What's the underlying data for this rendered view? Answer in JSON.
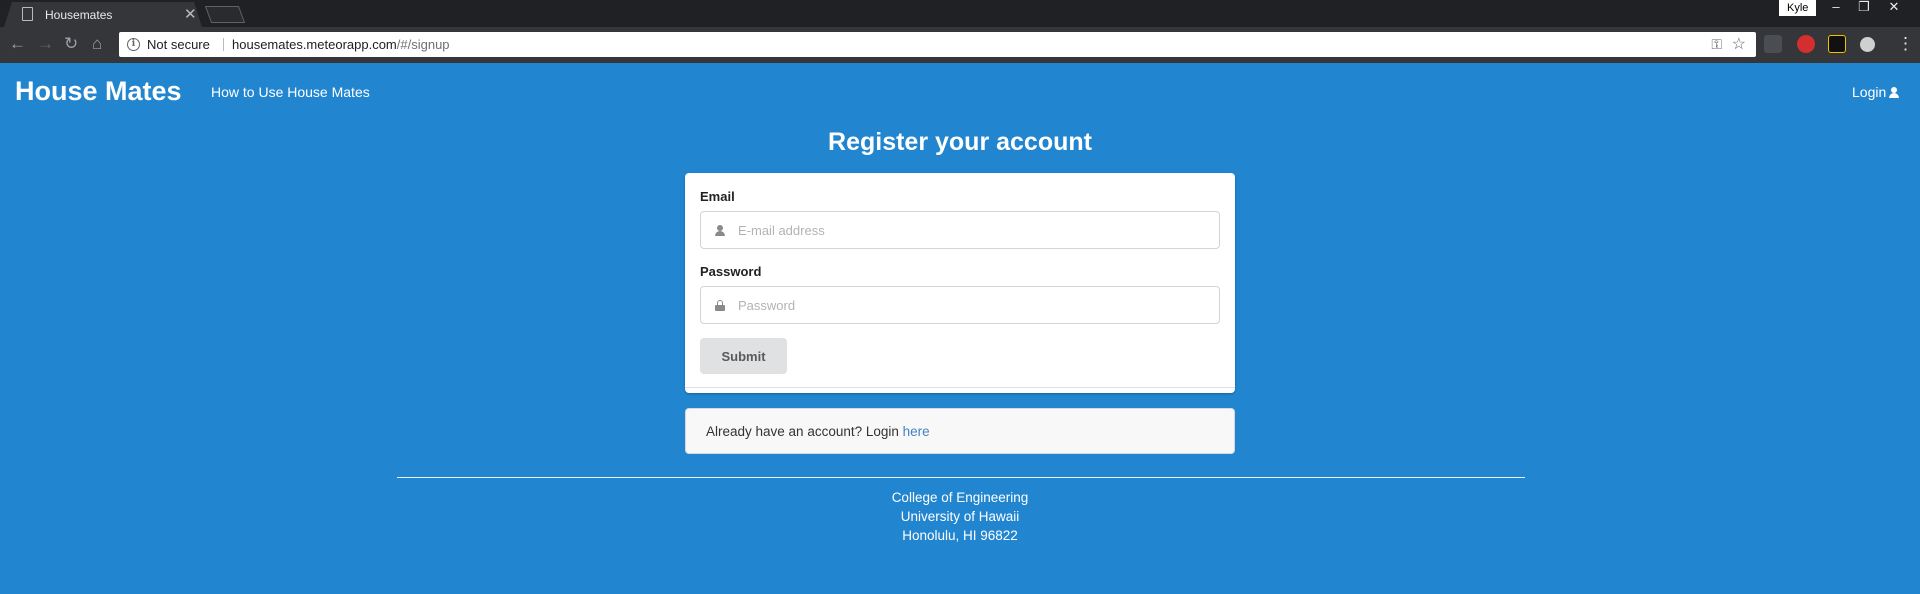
{
  "browser": {
    "tab_title": "Housemates",
    "profile_name": "Kyle",
    "security_text": "Not secure",
    "url_host": "housemates.meteorapp.com",
    "url_path": "/#/signup"
  },
  "nav": {
    "brand": "House Mates",
    "howto": "How to Use House Mates",
    "login": "Login"
  },
  "form": {
    "heading": "Register your account",
    "email_label": "Email",
    "email_placeholder": "E-mail address",
    "password_label": "Password",
    "password_placeholder": "Password",
    "submit_label": "Submit"
  },
  "message": {
    "text": "Already have an account? Login ",
    "link": "here"
  },
  "footer": {
    "line1": "College of Engineering",
    "line2": "University of Hawaii",
    "line3": "Honolulu, HI 96822"
  },
  "colors": {
    "page_background": "#2185d0",
    "link": "#4183c4"
  }
}
